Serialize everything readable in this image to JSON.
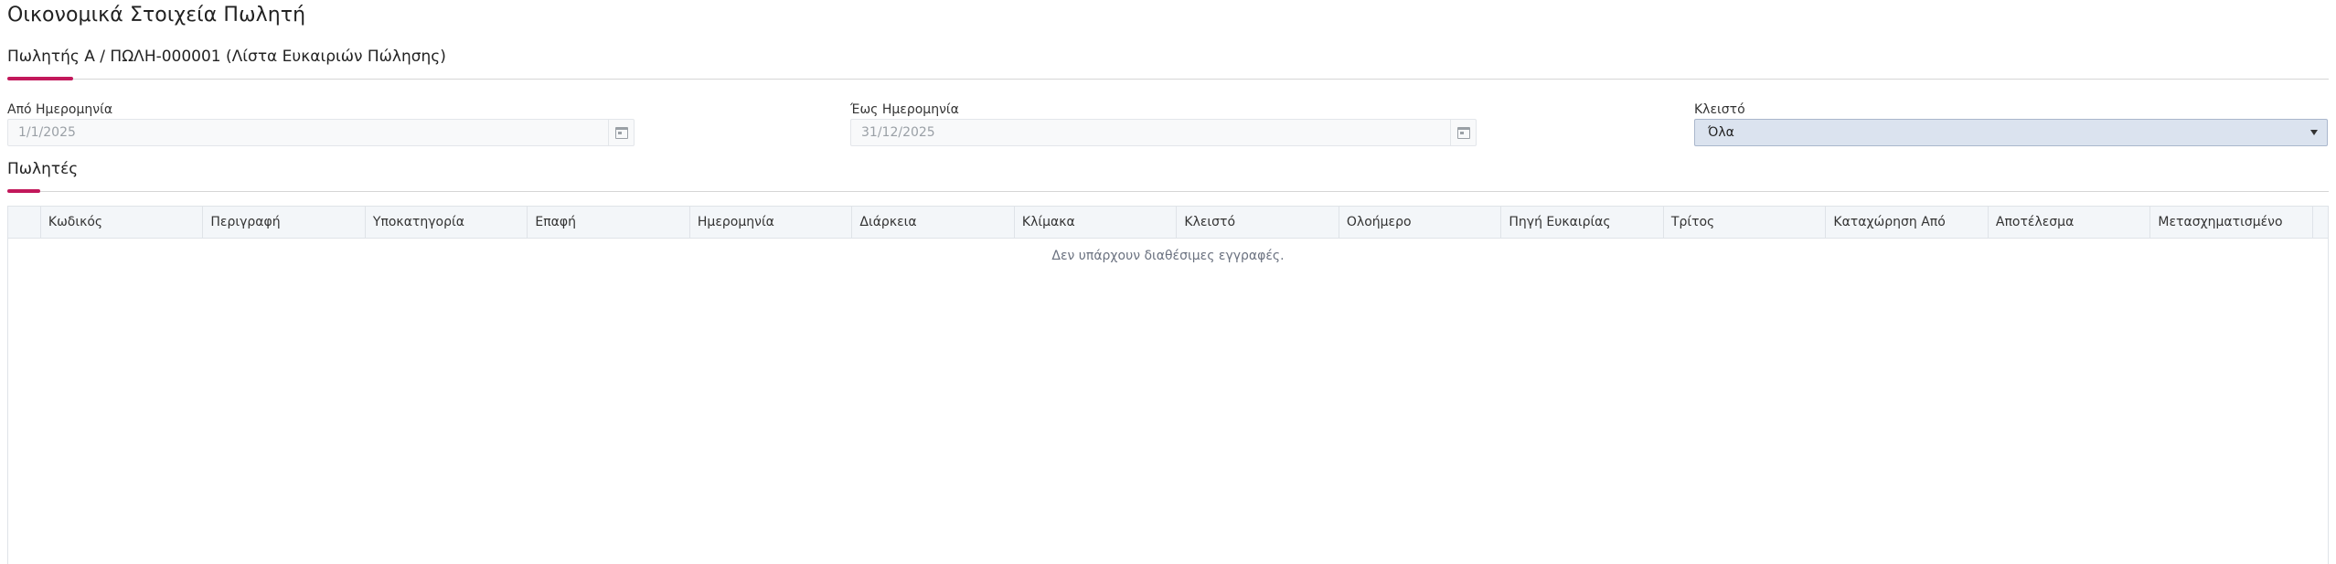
{
  "page": {
    "title": "Οικονομικά Στοιχεία Πωλητή"
  },
  "header_section": {
    "title": "Πωλητής Α / ΠΩΛΗ-000001 (Λίστα Ευκαιριών Πώλησης)"
  },
  "filters": {
    "from_date": {
      "label": "Από Ημερομηνία",
      "value": "1/1/2025"
    },
    "to_date": {
      "label": "Έως Ημερομηνία",
      "value": "31/12/2025"
    },
    "closed": {
      "label": "Κλειστό",
      "value": "Όλα"
    }
  },
  "grid_section": {
    "title": "Πωλητές"
  },
  "grid": {
    "columns": [
      "Κωδικός",
      "Περιγραφή",
      "Υποκατηγορία",
      "Επαφή",
      "Ημερομηνία",
      "Διάρκεια",
      "Κλίμακα",
      "Κλειστό",
      "Ολοήμερο",
      "Πηγή Ευκαιρίας",
      "Τρίτος",
      "Καταχώρηση Από",
      "Αποτέλεσμα",
      "Μετασχηματισμένο"
    ],
    "empty_message": "Δεν υπάρχουν διαθέσιμες εγγραφές."
  },
  "icons": {
    "date_picker": "calendar-icon",
    "dropdown": "chevron-down-icon"
  },
  "colors": {
    "accent": "#c2185b",
    "select_bg": "#dbe3ef",
    "header_bg": "#f3f6f9"
  }
}
